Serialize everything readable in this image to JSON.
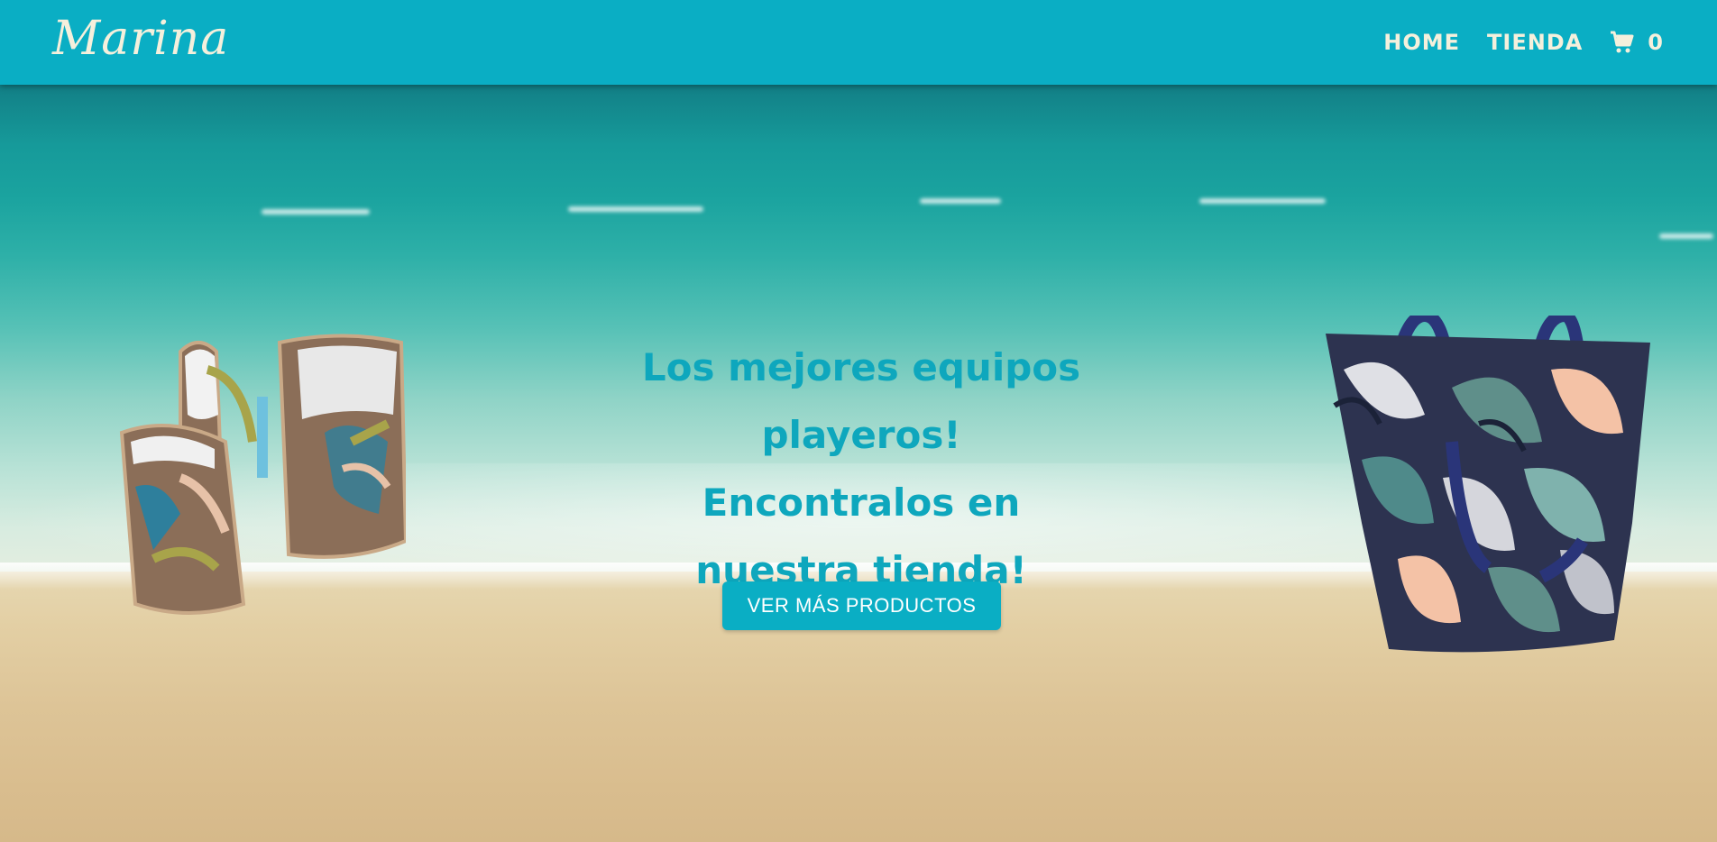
{
  "header": {
    "logo_text": "Marina",
    "nav": [
      {
        "label": "HOME"
      },
      {
        "label": "TIENDA"
      }
    ],
    "cart_count": "0"
  },
  "hero": {
    "headline": "Los mejores equipos playeros! Encontralos en nuestra tienda!",
    "cta_label": "VER MÁS PRODUCTOS"
  },
  "colors": {
    "brand": "#0aaec4",
    "headline": "#0ea7bd",
    "logo": "#f5f0dc"
  },
  "icons": {
    "cart": "shopping-cart-icon"
  }
}
